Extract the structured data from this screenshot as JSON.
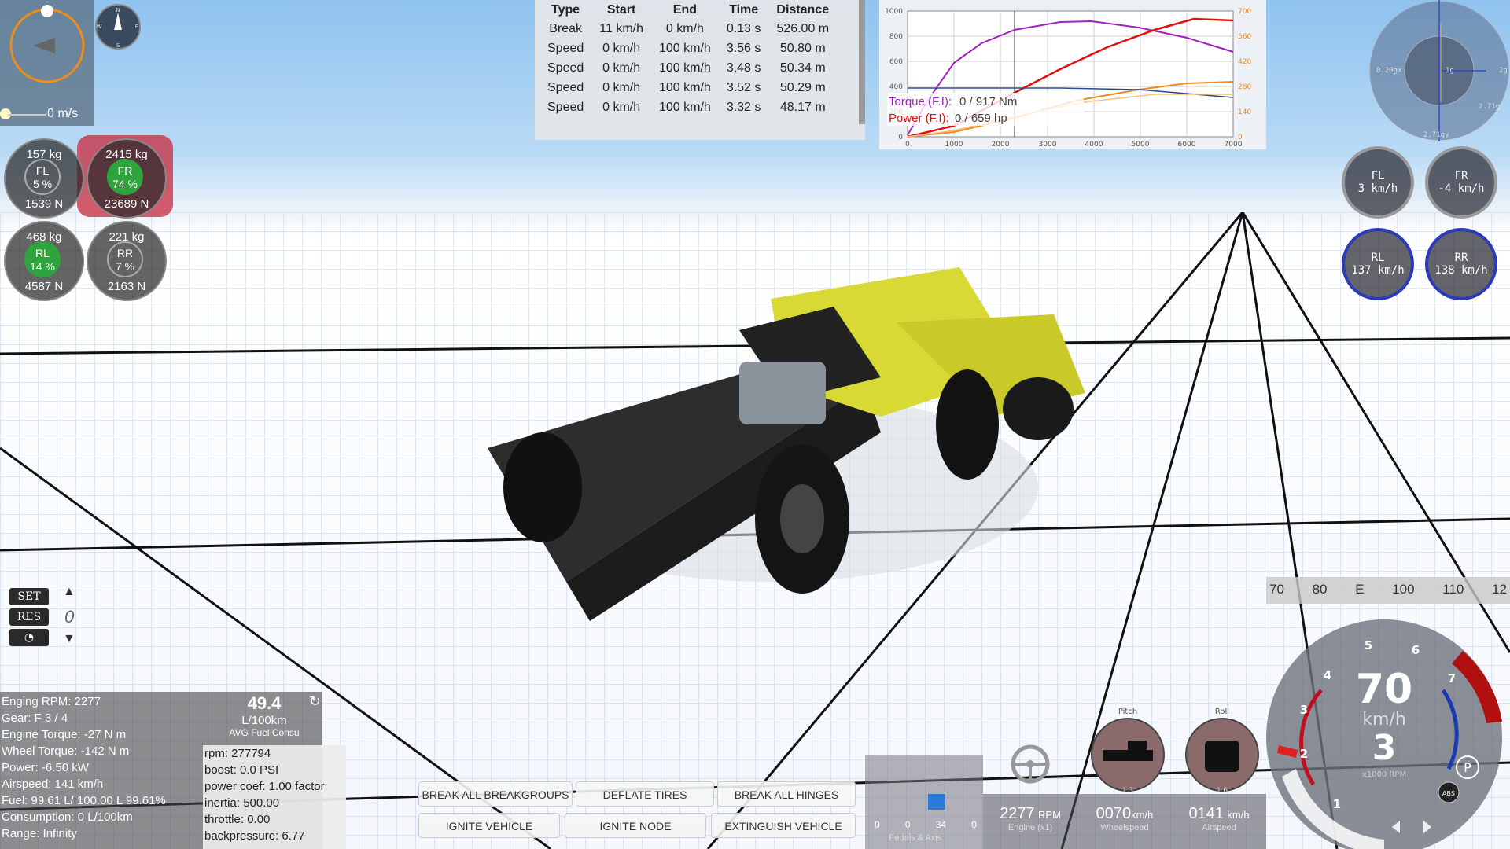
{
  "telemetry": {
    "headers": [
      "Type",
      "Start",
      "End",
      "Time",
      "Distance"
    ],
    "rows": [
      [
        "Break",
        "11 km/h",
        "0 km/h",
        "0.13 s",
        "526.00 m"
      ],
      [
        "Speed",
        "0 km/h",
        "100 km/h",
        "3.56 s",
        "50.80 m"
      ],
      [
        "Speed",
        "0 km/h",
        "100 km/h",
        "3.48 s",
        "50.34 m"
      ],
      [
        "Speed",
        "0 km/h",
        "100 km/h",
        "3.52 s",
        "50.29 m"
      ],
      [
        "Speed",
        "0 km/h",
        "100 km/h",
        "3.32 s",
        "48.17 m"
      ]
    ]
  },
  "torque_graph": {
    "torque_label": "Torque (F.I):",
    "torque_value": "0 / 917 Nm",
    "power_label": "Power (F.I):",
    "power_value": "0 / 659 hp",
    "left_ticks": [
      "1000",
      "800",
      "600",
      "400",
      "200",
      "0"
    ],
    "right_ticks": [
      "700",
      "560",
      "420",
      "280",
      "140",
      "0"
    ],
    "x_ticks": [
      "0",
      "1000",
      "2000",
      "3000",
      "4000",
      "5000",
      "6000",
      "7000"
    ],
    "colors": {
      "torque": "#a020c0",
      "power": "#e01010",
      "orange": "#f08a20",
      "blue": "#2a4a90"
    }
  },
  "orientation": {
    "speed": "0 m/s"
  },
  "compass": {
    "n": "N",
    "s": "S",
    "w": "W",
    "e": "E"
  },
  "wheels_left": [
    {
      "id": "FL",
      "mass": "157 kg",
      "pct": "5 %",
      "force": "1539 N",
      "active": false
    },
    {
      "id": "FR",
      "mass": "2415 kg",
      "pct": "74 %",
      "force": "23689 N",
      "active": true
    },
    {
      "id": "RL",
      "mass": "468 kg",
      "pct": "14 %",
      "force": "4587 N",
      "active": true
    },
    {
      "id": "RR",
      "mass": "221 kg",
      "pct": "7 %",
      "force": "2163 N",
      "active": false
    }
  ],
  "gforce": {
    "left": "0.20gx",
    "right": "2g",
    "lr": "2.71g",
    "bottom": "2.71gy",
    "center": "1g"
  },
  "wheel_speeds": [
    {
      "id": "FL",
      "speed": "3 km/h"
    },
    {
      "id": "FR",
      "speed": "-4 km/h"
    },
    {
      "id": "RL",
      "speed": "137 km/h"
    },
    {
      "id": "RR",
      "speed": "138 km/h"
    }
  ],
  "cruise": {
    "set": "SET",
    "res": "RES",
    "value": "0"
  },
  "debug": {
    "lines": [
      "Enging RPM: 2277",
      "Gear: F 3 / 4",
      "Engine Torque: -27 N m",
      "Wheel Torque: -142 N m",
      "Power: -6.50 kW",
      "Airspeed: 141 km/h",
      "Fuel: 99.61 L/ 100.00 L 99.61%",
      "Consumption: 0 L/100km",
      "Range: Infinity"
    ],
    "fuel_value": "49.4",
    "fuel_unit": "L/100km",
    "fuel_label": "AVG Fuel Consu",
    "sub": [
      "rpm: 277794",
      "boost: 0.0 PSI",
      "power coef: 1.00 factor",
      "inertia: 500.00",
      "throttle: 0.00",
      "backpressure: 6.77"
    ]
  },
  "buttons": {
    "break_breakgroups": "BREAK ALL BREAKGROUPS",
    "deflate_tires": "DEFLATE TIRES",
    "break_hinges": "BREAK ALL HINGES",
    "ignite_vehicle": "IGNITE VEHICLE",
    "ignite_node": "IGNITE NODE",
    "extinguish_vehicle": "EXTINGUISH VEHICLE"
  },
  "pedals": {
    "values": [
      "0",
      "0",
      "34",
      "0"
    ],
    "label": "Pedals & Axis",
    "steer_progress": 0.34
  },
  "readouts": {
    "rpm": {
      "value": "2277",
      "unit": "RPM",
      "label": "Engine (x1)"
    },
    "wheelspeed": {
      "value": "0070",
      "unit": "km/h",
      "label": "Wheelspeed"
    },
    "airspeed": {
      "value": "0141",
      "unit": "km/h",
      "label": "Airspeed"
    },
    "pitch": {
      "label": "Pitch",
      "value": "1.3"
    },
    "roll": {
      "label": "Roll",
      "value": "1.6"
    }
  },
  "heading_tape": [
    "70",
    "80",
    "E",
    "100",
    "110",
    "12"
  ],
  "tach": {
    "speed": "70",
    "unit": "km/h",
    "gear": "3",
    "rpm_label": "x1000 RPM",
    "ticks": [
      "1",
      "2",
      "3",
      "4",
      "5",
      "6",
      "7"
    ],
    "park": "P",
    "abs": "ABS"
  }
}
